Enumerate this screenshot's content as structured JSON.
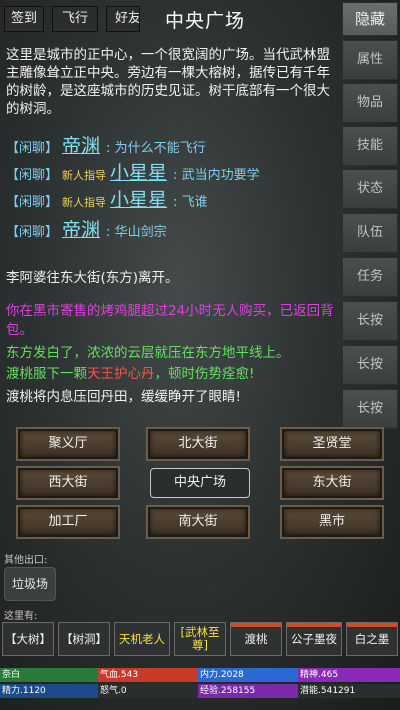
{
  "topbar": {
    "checkin": "签到",
    "fly": "飞行",
    "friends": "好友",
    "title": "中央广场"
  },
  "sidebar": {
    "hide": "隐藏",
    "items": [
      "属性",
      "物品",
      "技能",
      "状态",
      "队伍",
      "任务",
      "长按",
      "长按",
      "长按"
    ]
  },
  "description": "这里是城市的正中心，一个很宽阔的广场。当代武林盟主雕像耸立正中央。旁边有一棵大榕树，据传已有千年的树龄，是这座城市的历史见证。树干底部有一个很大的树洞。",
  "chat": [
    {
      "tag": "【闲聊】",
      "newbie": "",
      "name": "帝渊",
      "colon": ":",
      "msg": "为什么不能飞行"
    },
    {
      "tag": "【闲聊】",
      "newbie": "新人指导",
      "name": "小星星",
      "colon": ":",
      "msg": "武当内功要学"
    },
    {
      "tag": "【闲聊】",
      "newbie": "新人指导",
      "name": "小星星",
      "colon": ":",
      "msg": "飞谁"
    },
    {
      "tag": "【闲聊】",
      "newbie": "",
      "name": "帝渊",
      "colon": ":",
      "msg": "华山剑宗"
    }
  ],
  "log": {
    "line1": "李阿婆往东大街(东方)离开。",
    "line2": "你在黑市寄售的烤鸡腿超过24小时无人购买，已返回背包。",
    "line3": "东方发白了，浓浓的云层就压在东方地平线上。",
    "line4_pre": "渡桃服下一颗",
    "line4_item": "天王护心丹",
    "line4_post": "，顿时伤势痊愈!",
    "line5": "渡桃将内息压回丹田，缓缓睁开了眼睛!"
  },
  "exits": {
    "nw": "聚义厅",
    "n": "北大街",
    "ne": "圣贤堂",
    "w": "西大街",
    "center": "中央广场",
    "e": "东大街",
    "sw": "加工厂",
    "s": "南大街",
    "se": "黑市"
  },
  "other_exits": {
    "label": "其他出口:",
    "trash": "垃圾场"
  },
  "here": {
    "label": "这里有:",
    "npcs": [
      {
        "label": "【大树】",
        "yellow": false,
        "hp": null
      },
      {
        "label": "【树洞】",
        "yellow": false,
        "hp": null
      },
      {
        "label": "天机老人",
        "yellow": true,
        "hp": null
      },
      {
        "label": "[武林至尊]",
        "yellow": true,
        "hp": null
      },
      {
        "label": "渡桃",
        "yellow": false,
        "hp": 1.0
      },
      {
        "label": "公子墨夜",
        "yellow": false,
        "hp": 1.0
      },
      {
        "label": "白之墨",
        "yellow": false,
        "hp": 1.0
      }
    ]
  },
  "stats": {
    "zihua": "奈白",
    "qixue": "气血.543",
    "neili": "内力.2028",
    "jingshen": "精神.465",
    "jingli": "精力.1120",
    "nuqi": "怒气.0",
    "jingyan": "经验.258155",
    "qianneng": "潜能.541291"
  },
  "colors": {
    "chat_tag": "#7fd0f0",
    "newbie": "#f0d060",
    "system_magenta": "#e040e0",
    "green": "#66e060",
    "item_red": "#ff5050",
    "hp_red": "#c83a2a",
    "mp_blue": "#2a6ad2",
    "exp_purple": "#8a2ab8"
  }
}
